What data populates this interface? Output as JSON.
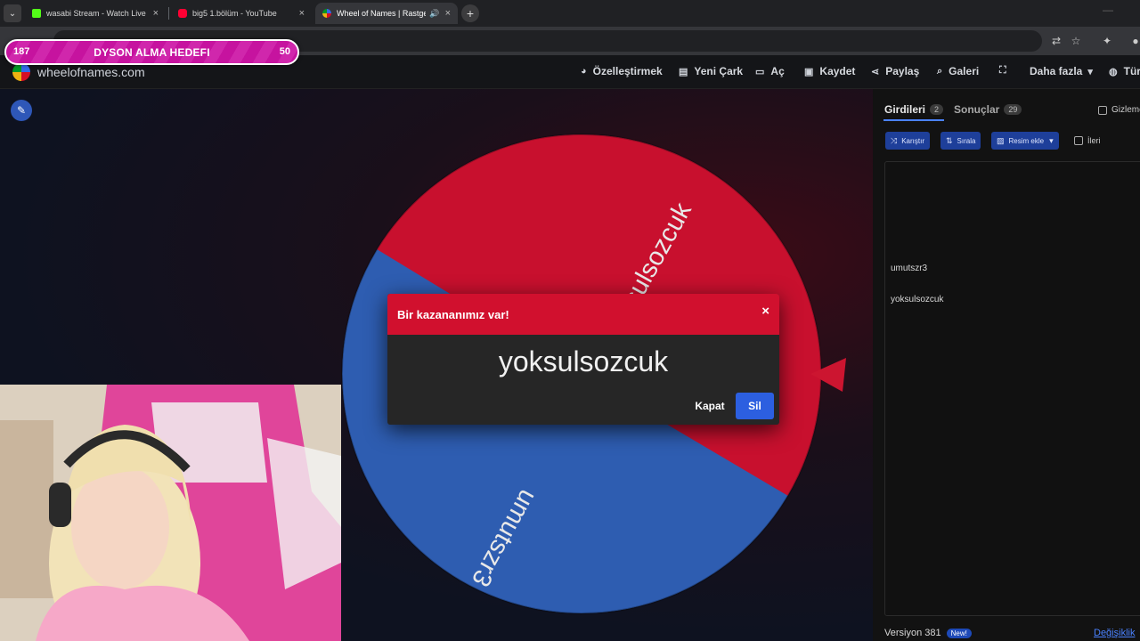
{
  "browser": {
    "tabs": [
      {
        "title": "wasabi Stream - Watch Live on",
        "favicon_color": "#53fc18",
        "audio": false
      },
      {
        "title": "big5 1.bölüm - YouTube",
        "favicon_color": "#ff0033",
        "audio": false
      },
      {
        "title": "Wheel of Names | Rastgele",
        "favicon_color": "#eeb211",
        "audio": true
      }
    ],
    "close_glyph": "×",
    "new_tab_glyph": "+",
    "menu_glyph": "⌄"
  },
  "overlay": {
    "goal_title": "DYSON ALMA HEDEFI",
    "goal_current": "187",
    "goal_target": "50",
    "goal_progress": 1.0
  },
  "site": {
    "name": "wheelofnames.com",
    "nav": [
      {
        "label": "Özelleştirmek",
        "icon": "palette-icon",
        "glyph": "◕"
      },
      {
        "label": "Yeni Çark",
        "icon": "file-icon",
        "glyph": "▤"
      },
      {
        "label": "Aç",
        "icon": "folder-icon",
        "glyph": "▭"
      },
      {
        "label": "Kaydet",
        "icon": "save-icon",
        "glyph": "▣"
      },
      {
        "label": "Paylaş",
        "icon": "share-icon",
        "glyph": "⋖"
      },
      {
        "label": "Galeri",
        "icon": "search-icon",
        "glyph": "⌕"
      },
      {
        "label": "",
        "icon": "fullscreen-icon",
        "glyph": "⛶"
      },
      {
        "label": "Daha fazla",
        "icon": "chevron-down-icon",
        "glyph": "▾"
      },
      {
        "label": "Tür",
        "icon": "globe-icon",
        "glyph": "◍"
      }
    ]
  },
  "wheel": {
    "entries": [
      "yoksulsozcuk",
      "umutszr3"
    ],
    "colors": {
      "red": "#c8102e",
      "blue": "#2e5db1",
      "pointer": "#cc1530"
    }
  },
  "dialog": {
    "title": "Bir kazananımız var!",
    "winner": "yoksulsozcuk",
    "close_label": "Kapat",
    "delete_label": "Sil",
    "close_glyph": "×"
  },
  "sidebar": {
    "tab_entries": "Girdileri",
    "tab_entries_count": "2",
    "tab_results": "Sonuçlar",
    "tab_results_count": "29",
    "hide_label": "Gizleme",
    "shuffle_label": "Karıştır",
    "sort_label": "Sırala",
    "add_image_label": "Resim ekle",
    "advanced_label": "İleri",
    "entries": [
      "umutszr3",
      "yoksulsozcuk"
    ],
    "version": "Versiyon 381",
    "new_badge": "New!",
    "changes_link": "Değişiklik"
  }
}
